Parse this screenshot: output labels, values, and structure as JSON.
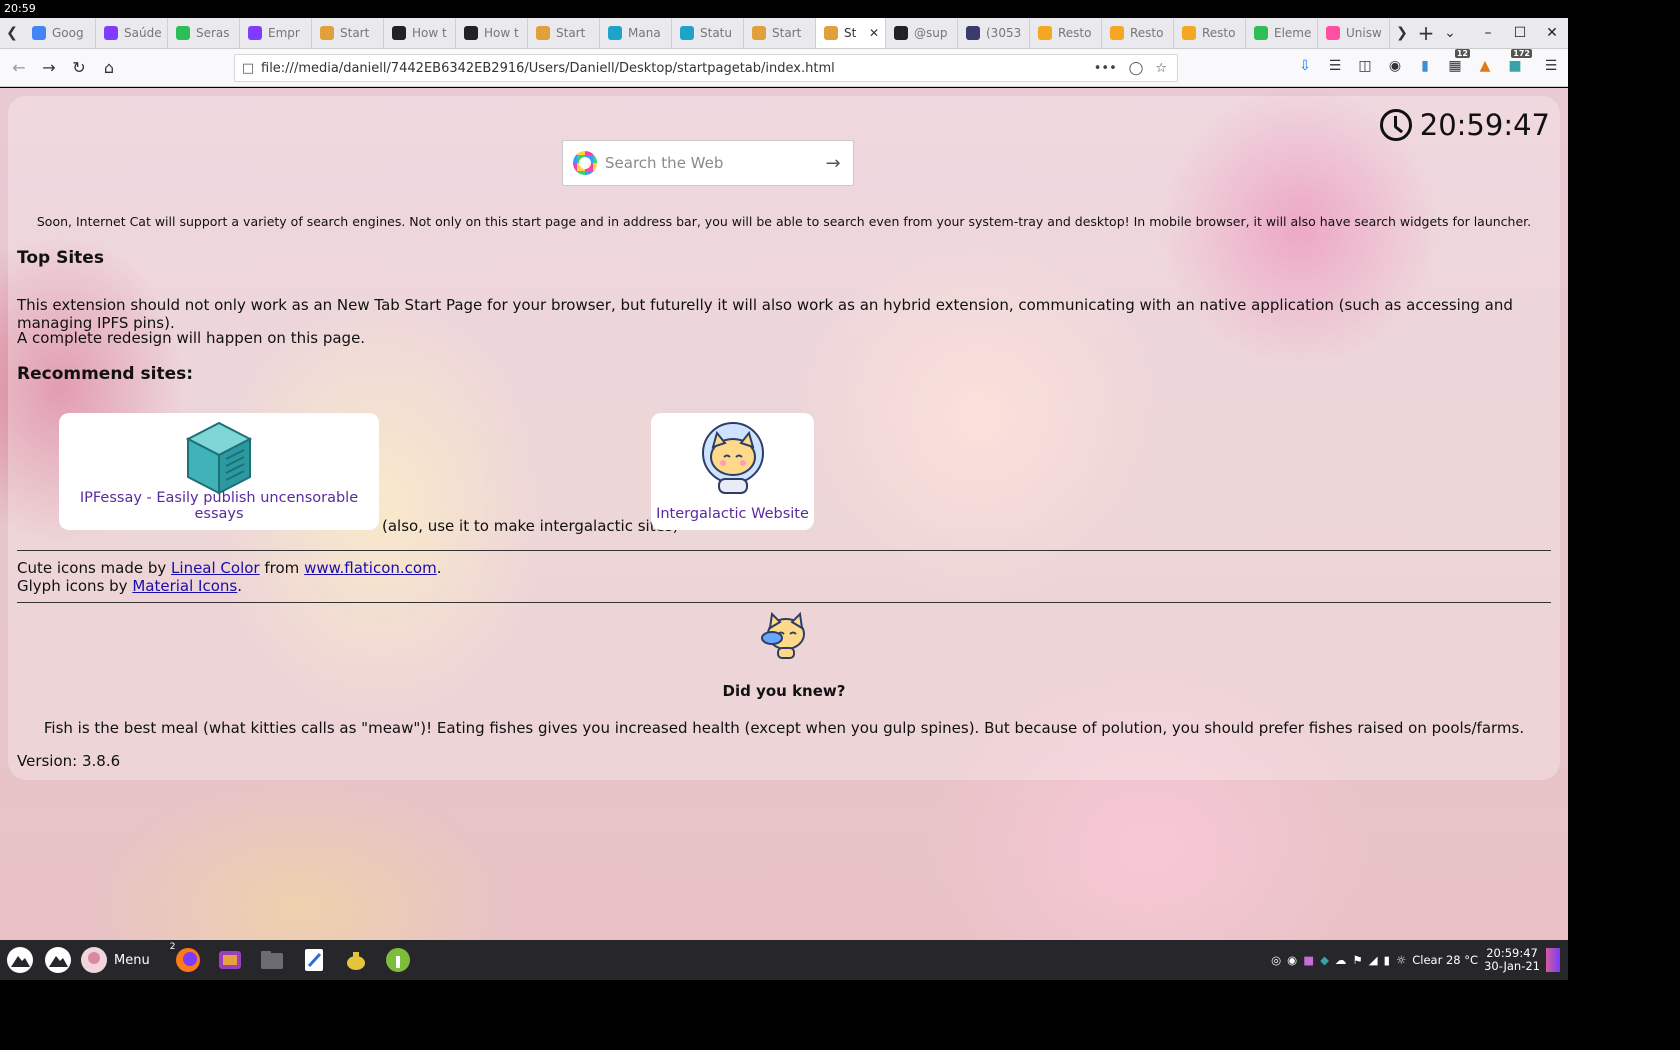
{
  "system": {
    "time": "20:59"
  },
  "tabs": [
    {
      "title": "Goog",
      "color": "#4285f4"
    },
    {
      "title": "Saúde",
      "color": "#7d3cff"
    },
    {
      "title": "Seras",
      "color": "#2dbf55"
    },
    {
      "title": "Empr",
      "color": "#7d3cff"
    },
    {
      "title": "Start",
      "color": "#e0a03b"
    },
    {
      "title": "How t",
      "color": "#222222"
    },
    {
      "title": "How t",
      "color": "#222222"
    },
    {
      "title": "Start",
      "color": "#e0a03b"
    },
    {
      "title": "Mana",
      "color": "#1fa3c9"
    },
    {
      "title": "Statu",
      "color": "#1fa3c9"
    },
    {
      "title": "Start",
      "color": "#e0a03b"
    },
    {
      "title": "St",
      "color": "#e0a03b",
      "active": true
    },
    {
      "title": "@sup",
      "color": "#222222"
    },
    {
      "title": "(3053",
      "color": "#3a3a6b"
    },
    {
      "title": "Resto",
      "color": "#f5a623"
    },
    {
      "title": "Resto",
      "color": "#f5a623"
    },
    {
      "title": "Resto",
      "color": "#f5a623"
    },
    {
      "title": "Eleme",
      "color": "#2dbf55"
    },
    {
      "title": "Unisw",
      "color": "#ff4fa3"
    }
  ],
  "url": "file:///media/daniell/7442EB6342EB2916/Users/Daniell/Desktop/startpagetab/index.html",
  "toolbar": {
    "extension_badge_1": "12",
    "extension_badge_2": "172"
  },
  "clock": {
    "time": "20:59:47"
  },
  "search": {
    "placeholder": "Search the Web"
  },
  "notice": "Soon, Internet Cat will support a variety of search engines. Not only on this start page and in address bar, you will be able to search even from your system-tray and desktop! In mobile browser, it will also have search widgets for launcher.",
  "top_sites": {
    "heading": "Top Sites",
    "paragraph_1": "This extension should not only work as an New Tab Start Page for your browser, but futurelly it will also work as an hybrid extension, communicating with an native application (such as accessing and managing IPFS pins).",
    "paragraph_2": "A complete redesign will happen on this page."
  },
  "recommend": {
    "heading": "Recommend sites:",
    "site_1": "IPFessay - Easily publish uncensorable essays",
    "between": "(also, use it to make intergalactic sites)",
    "site_2": "Intergalactic Website"
  },
  "credits": {
    "line1_prefix": "Cute icons made by",
    "line1_author": "Lineal Color",
    "line1_mid": "from",
    "line1_site": "www.flaticon.com",
    "line1_end": ".",
    "line2_prefix": "Glyph icons by",
    "line2_link": "Material Icons",
    "line2_end": "."
  },
  "did_you_know": {
    "title": "Did you knew?",
    "text": "Fish is the best meal (what kitties calls as \"meaw\")! Eating fishes gives you increased health (except when you gulp spines). But because of polution, you should prefer fishes raised on pools/farms."
  },
  "version": "Version: 3.8.6",
  "taskbar": {
    "menu_label": "Menu",
    "firefox_badge": "2",
    "weather": "Clear 28 °C",
    "time": "20:59:47",
    "date": "30-Jan-21"
  }
}
